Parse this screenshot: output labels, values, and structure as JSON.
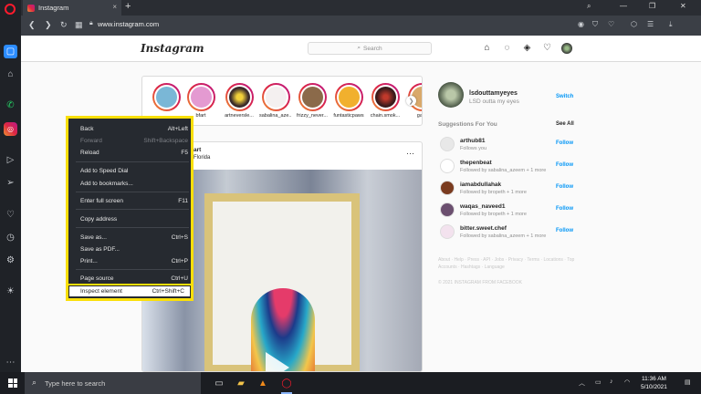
{
  "browser": {
    "tab_title": "Instagram",
    "url": "www.instagram.com",
    "new_tab": "+",
    "tab_close": "×"
  },
  "header": {
    "logo": "Instagram",
    "search_placeholder": "Search"
  },
  "stories": [
    {
      "name": "",
      "color": "#7ab7d6"
    },
    {
      "name": "bfart",
      "color": "#e49ad1"
    },
    {
      "name": "artneversle...",
      "color": "#3a2a2a"
    },
    {
      "name": "sabalina_aze...",
      "color": "#f4f0f0"
    },
    {
      "name": "frizzy_never...",
      "color": "#8b6a4a"
    },
    {
      "name": "funtasticpaws",
      "color": "#f1b02e"
    },
    {
      "name": "chain.smok...",
      "color": "#3b1b1b"
    },
    {
      "name": "ganj",
      "color": "#d9a96a"
    }
  ],
  "post": {
    "username": "art",
    "location": "Florida",
    "more": "···"
  },
  "profile": {
    "username": "lsdouttamyeyes",
    "full_name": "LSD outta my eyes",
    "switch_label": "Switch"
  },
  "suggestions": {
    "title": "Suggestions For You",
    "see_all": "See All",
    "follow_label": "Follow",
    "items": [
      {
        "username": "arthub81",
        "subtitle": "Follows you",
        "color": "#e8e8e8"
      },
      {
        "username": "thepenbeat",
        "subtitle": "Followed by sabalina_azeem + 1 more",
        "color": "#ffffff"
      },
      {
        "username": "iamabdullahak",
        "subtitle": "Followed by bropeth + 1 more",
        "color": "#7a3b1f"
      },
      {
        "username": "waqas_naveed1",
        "subtitle": "Followed by bropeth + 1 more",
        "color": "#6b4f6f"
      },
      {
        "username": "bitter.sweet.chef",
        "subtitle": "Followed by sabalina_azeem + 1 more",
        "color": "#f3e2ee"
      }
    ]
  },
  "footer": {
    "links": "About · Help · Press · API · Jobs · Privacy · Terms · Locations · Top Accounts · Hashtags · Language",
    "copyright": "© 2021 INSTAGRAM FROM FACEBOOK"
  },
  "context_menu": {
    "items": [
      {
        "label": "Back",
        "shortcut": "Alt+Left",
        "disabled": false
      },
      {
        "label": "Forward",
        "shortcut": "Shift+Backspace",
        "disabled": true
      },
      {
        "label": "Reload",
        "shortcut": "F5",
        "disabled": false
      },
      {
        "label": "Add to Speed Dial",
        "shortcut": "",
        "disabled": false
      },
      {
        "label": "Add to bookmarks...",
        "shortcut": "",
        "disabled": false
      },
      {
        "label": "Enter full screen",
        "shortcut": "F11",
        "disabled": false
      },
      {
        "label": "Copy address",
        "shortcut": "",
        "disabled": false
      },
      {
        "label": "Save as...",
        "shortcut": "Ctrl+S",
        "disabled": false
      },
      {
        "label": "Save as PDF...",
        "shortcut": "",
        "disabled": false
      },
      {
        "label": "Print...",
        "shortcut": "Ctrl+P",
        "disabled": false
      },
      {
        "label": "Page source",
        "shortcut": "Ctrl+U",
        "disabled": false
      },
      {
        "label": "Inspect element",
        "shortcut": "Ctrl+Shift+C",
        "disabled": false
      }
    ]
  },
  "taskbar": {
    "search_placeholder": "Type here to search",
    "time": "11:36 AM",
    "date": "5/10/2021"
  }
}
